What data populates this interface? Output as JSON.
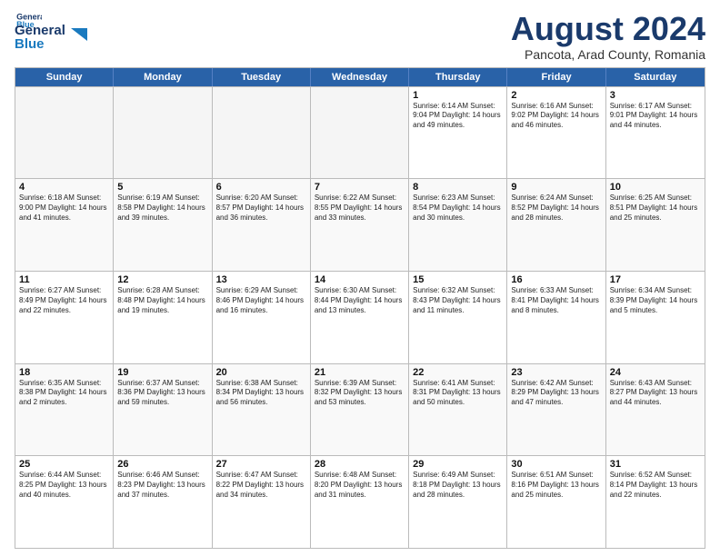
{
  "header": {
    "logo_general": "General",
    "logo_blue": "Blue",
    "month_title": "August 2024",
    "subtitle": "Pancota, Arad County, Romania"
  },
  "weekdays": [
    "Sunday",
    "Monday",
    "Tuesday",
    "Wednesday",
    "Thursday",
    "Friday",
    "Saturday"
  ],
  "rows": [
    [
      {
        "day": "",
        "info": "",
        "empty": true
      },
      {
        "day": "",
        "info": "",
        "empty": true
      },
      {
        "day": "",
        "info": "",
        "empty": true
      },
      {
        "day": "",
        "info": "",
        "empty": true
      },
      {
        "day": "1",
        "info": "Sunrise: 6:14 AM\nSunset: 9:04 PM\nDaylight: 14 hours\nand 49 minutes."
      },
      {
        "day": "2",
        "info": "Sunrise: 6:16 AM\nSunset: 9:02 PM\nDaylight: 14 hours\nand 46 minutes."
      },
      {
        "day": "3",
        "info": "Sunrise: 6:17 AM\nSunset: 9:01 PM\nDaylight: 14 hours\nand 44 minutes."
      }
    ],
    [
      {
        "day": "4",
        "info": "Sunrise: 6:18 AM\nSunset: 9:00 PM\nDaylight: 14 hours\nand 41 minutes."
      },
      {
        "day": "5",
        "info": "Sunrise: 6:19 AM\nSunset: 8:58 PM\nDaylight: 14 hours\nand 39 minutes."
      },
      {
        "day": "6",
        "info": "Sunrise: 6:20 AM\nSunset: 8:57 PM\nDaylight: 14 hours\nand 36 minutes."
      },
      {
        "day": "7",
        "info": "Sunrise: 6:22 AM\nSunset: 8:55 PM\nDaylight: 14 hours\nand 33 minutes."
      },
      {
        "day": "8",
        "info": "Sunrise: 6:23 AM\nSunset: 8:54 PM\nDaylight: 14 hours\nand 30 minutes."
      },
      {
        "day": "9",
        "info": "Sunrise: 6:24 AM\nSunset: 8:52 PM\nDaylight: 14 hours\nand 28 minutes."
      },
      {
        "day": "10",
        "info": "Sunrise: 6:25 AM\nSunset: 8:51 PM\nDaylight: 14 hours\nand 25 minutes."
      }
    ],
    [
      {
        "day": "11",
        "info": "Sunrise: 6:27 AM\nSunset: 8:49 PM\nDaylight: 14 hours\nand 22 minutes."
      },
      {
        "day": "12",
        "info": "Sunrise: 6:28 AM\nSunset: 8:48 PM\nDaylight: 14 hours\nand 19 minutes."
      },
      {
        "day": "13",
        "info": "Sunrise: 6:29 AM\nSunset: 8:46 PM\nDaylight: 14 hours\nand 16 minutes."
      },
      {
        "day": "14",
        "info": "Sunrise: 6:30 AM\nSunset: 8:44 PM\nDaylight: 14 hours\nand 13 minutes."
      },
      {
        "day": "15",
        "info": "Sunrise: 6:32 AM\nSunset: 8:43 PM\nDaylight: 14 hours\nand 11 minutes."
      },
      {
        "day": "16",
        "info": "Sunrise: 6:33 AM\nSunset: 8:41 PM\nDaylight: 14 hours\nand 8 minutes."
      },
      {
        "day": "17",
        "info": "Sunrise: 6:34 AM\nSunset: 8:39 PM\nDaylight: 14 hours\nand 5 minutes."
      }
    ],
    [
      {
        "day": "18",
        "info": "Sunrise: 6:35 AM\nSunset: 8:38 PM\nDaylight: 14 hours\nand 2 minutes."
      },
      {
        "day": "19",
        "info": "Sunrise: 6:37 AM\nSunset: 8:36 PM\nDaylight: 13 hours\nand 59 minutes."
      },
      {
        "day": "20",
        "info": "Sunrise: 6:38 AM\nSunset: 8:34 PM\nDaylight: 13 hours\nand 56 minutes."
      },
      {
        "day": "21",
        "info": "Sunrise: 6:39 AM\nSunset: 8:32 PM\nDaylight: 13 hours\nand 53 minutes."
      },
      {
        "day": "22",
        "info": "Sunrise: 6:41 AM\nSunset: 8:31 PM\nDaylight: 13 hours\nand 50 minutes."
      },
      {
        "day": "23",
        "info": "Sunrise: 6:42 AM\nSunset: 8:29 PM\nDaylight: 13 hours\nand 47 minutes."
      },
      {
        "day": "24",
        "info": "Sunrise: 6:43 AM\nSunset: 8:27 PM\nDaylight: 13 hours\nand 44 minutes."
      }
    ],
    [
      {
        "day": "25",
        "info": "Sunrise: 6:44 AM\nSunset: 8:25 PM\nDaylight: 13 hours\nand 40 minutes."
      },
      {
        "day": "26",
        "info": "Sunrise: 6:46 AM\nSunset: 8:23 PM\nDaylight: 13 hours\nand 37 minutes."
      },
      {
        "day": "27",
        "info": "Sunrise: 6:47 AM\nSunset: 8:22 PM\nDaylight: 13 hours\nand 34 minutes."
      },
      {
        "day": "28",
        "info": "Sunrise: 6:48 AM\nSunset: 8:20 PM\nDaylight: 13 hours\nand 31 minutes."
      },
      {
        "day": "29",
        "info": "Sunrise: 6:49 AM\nSunset: 8:18 PM\nDaylight: 13 hours\nand 28 minutes."
      },
      {
        "day": "30",
        "info": "Sunrise: 6:51 AM\nSunset: 8:16 PM\nDaylight: 13 hours\nand 25 minutes."
      },
      {
        "day": "31",
        "info": "Sunrise: 6:52 AM\nSunset: 8:14 PM\nDaylight: 13 hours\nand 22 minutes."
      }
    ]
  ]
}
